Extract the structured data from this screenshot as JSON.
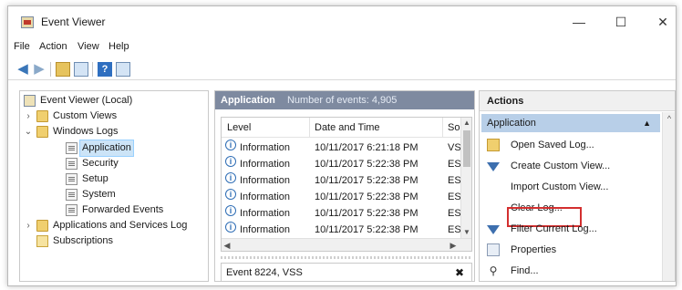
{
  "window": {
    "title": "Event Viewer",
    "controls": {
      "minimize": "—",
      "maximize": "☐",
      "close": "✕"
    }
  },
  "menu": [
    "File",
    "Action",
    "View",
    "Help"
  ],
  "toolbar": {
    "icons": [
      "back-arrow-icon",
      "forward-arrow-icon",
      "folder-up-icon",
      "console-tree-icon",
      "help-icon",
      "properties-icon"
    ]
  },
  "tree": {
    "root": "Event Viewer (Local)",
    "custom_views": "Custom Views",
    "windows_logs": "Windows Logs",
    "logs": [
      "Application",
      "Security",
      "Setup",
      "System",
      "Forwarded Events"
    ],
    "apps_services": "Applications and Services Log",
    "subscriptions": "Subscriptions",
    "selected": "Application"
  },
  "middle": {
    "log_name": "Application",
    "event_count": "Number of events: 4,905",
    "columns": [
      "Level",
      "Date and Time",
      "So"
    ],
    "rows": [
      {
        "level": "Information",
        "datetime": "10/11/2017 6:21:18 PM",
        "source": "VS"
      },
      {
        "level": "Information",
        "datetime": "10/11/2017 5:22:38 PM",
        "source": "ESI"
      },
      {
        "level": "Information",
        "datetime": "10/11/2017 5:22:38 PM",
        "source": "ESI"
      },
      {
        "level": "Information",
        "datetime": "10/11/2017 5:22:38 PM",
        "source": "ESI"
      },
      {
        "level": "Information",
        "datetime": "10/11/2017 5:22:38 PM",
        "source": "ESI"
      },
      {
        "level": "Information",
        "datetime": "10/11/2017 5:22:38 PM",
        "source": "ESI"
      }
    ],
    "event_detail_title": "Event 8224, VSS",
    "close_glyph": "✖"
  },
  "actions": {
    "header": "Actions",
    "section": "Application",
    "items": [
      "Open Saved Log...",
      "Create Custom View...",
      "Import Custom View...",
      "Clear Log...",
      "Filter Current Log...",
      "Properties",
      "Find..."
    ]
  },
  "colors": {
    "highlight_border": "#d32f2f",
    "section_bg": "#b8cfe8",
    "header_bg": "#7e8aa0"
  }
}
